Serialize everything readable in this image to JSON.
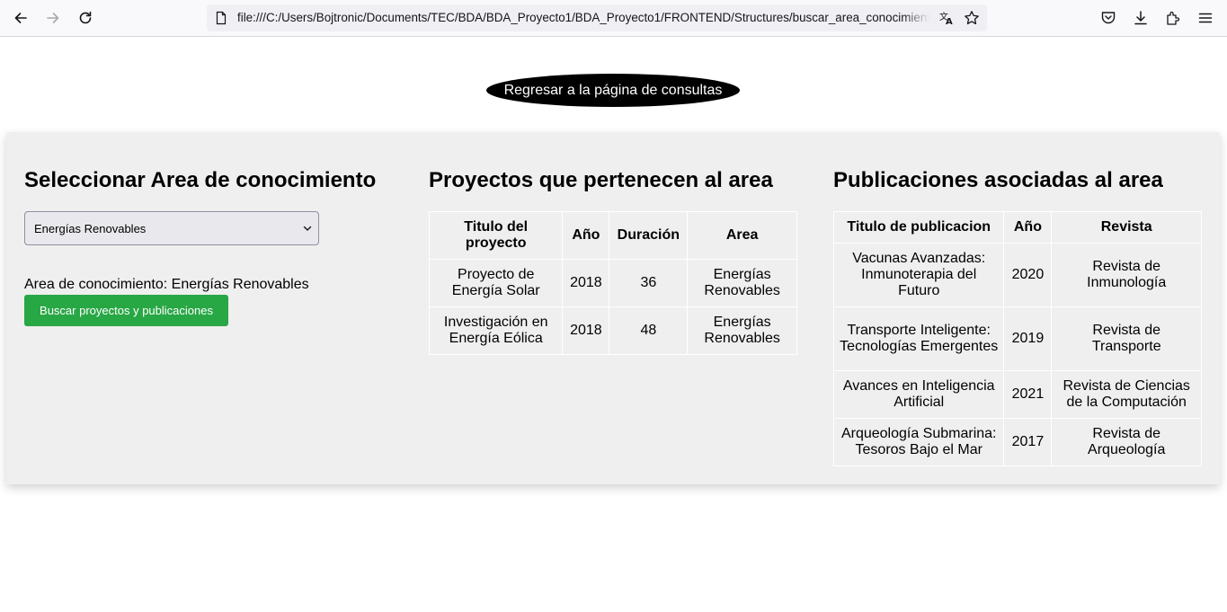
{
  "browser": {
    "url": "file:///C:/Users/Bojtronic/Documents/TEC/BDA/BDA_Proyecto1/BDA_Proyecto1/FRONTEND/Structures/buscar_area_conocimiento.html"
  },
  "page": {
    "back_button_label": "Regresar a la página de consultas"
  },
  "selector": {
    "title": "Seleccionar Area de conocimiento",
    "selected_option": "Energías Renovables",
    "area_label": "Area de conocimiento: Energías Renovables",
    "search_button_label": "Buscar proyectos y publicaciones"
  },
  "projects": {
    "title": "Proyectos que pertenecen al area",
    "headers": [
      "Titulo del proyecto",
      "Año",
      "Duración",
      "Area"
    ],
    "rows": [
      [
        "Proyecto de Energía Solar",
        "2018",
        "36",
        "Energías Renovables"
      ],
      [
        "Investigación en Energía Eólica",
        "2018",
        "48",
        "Energías Renovables"
      ]
    ]
  },
  "publications": {
    "title": "Publicaciones asociadas al area",
    "headers": [
      "Titulo de publicacion",
      "Año",
      "Revista"
    ],
    "rows": [
      [
        "Vacunas Avanzadas: Inmunoterapia del Futuro",
        "2020",
        "Revista de Inmunología"
      ],
      [
        "Transporte Inteligente: Tecnologías Emergentes",
        "2019",
        "Revista de Transporte"
      ],
      [
        "Avances en Inteligencia Artificial",
        "2021",
        "Revista de Ciencias de la Computación"
      ],
      [
        "Arqueología Submarina: Tesoros Bajo el Mar",
        "2017",
        "Revista de Arqueología"
      ]
    ]
  }
}
